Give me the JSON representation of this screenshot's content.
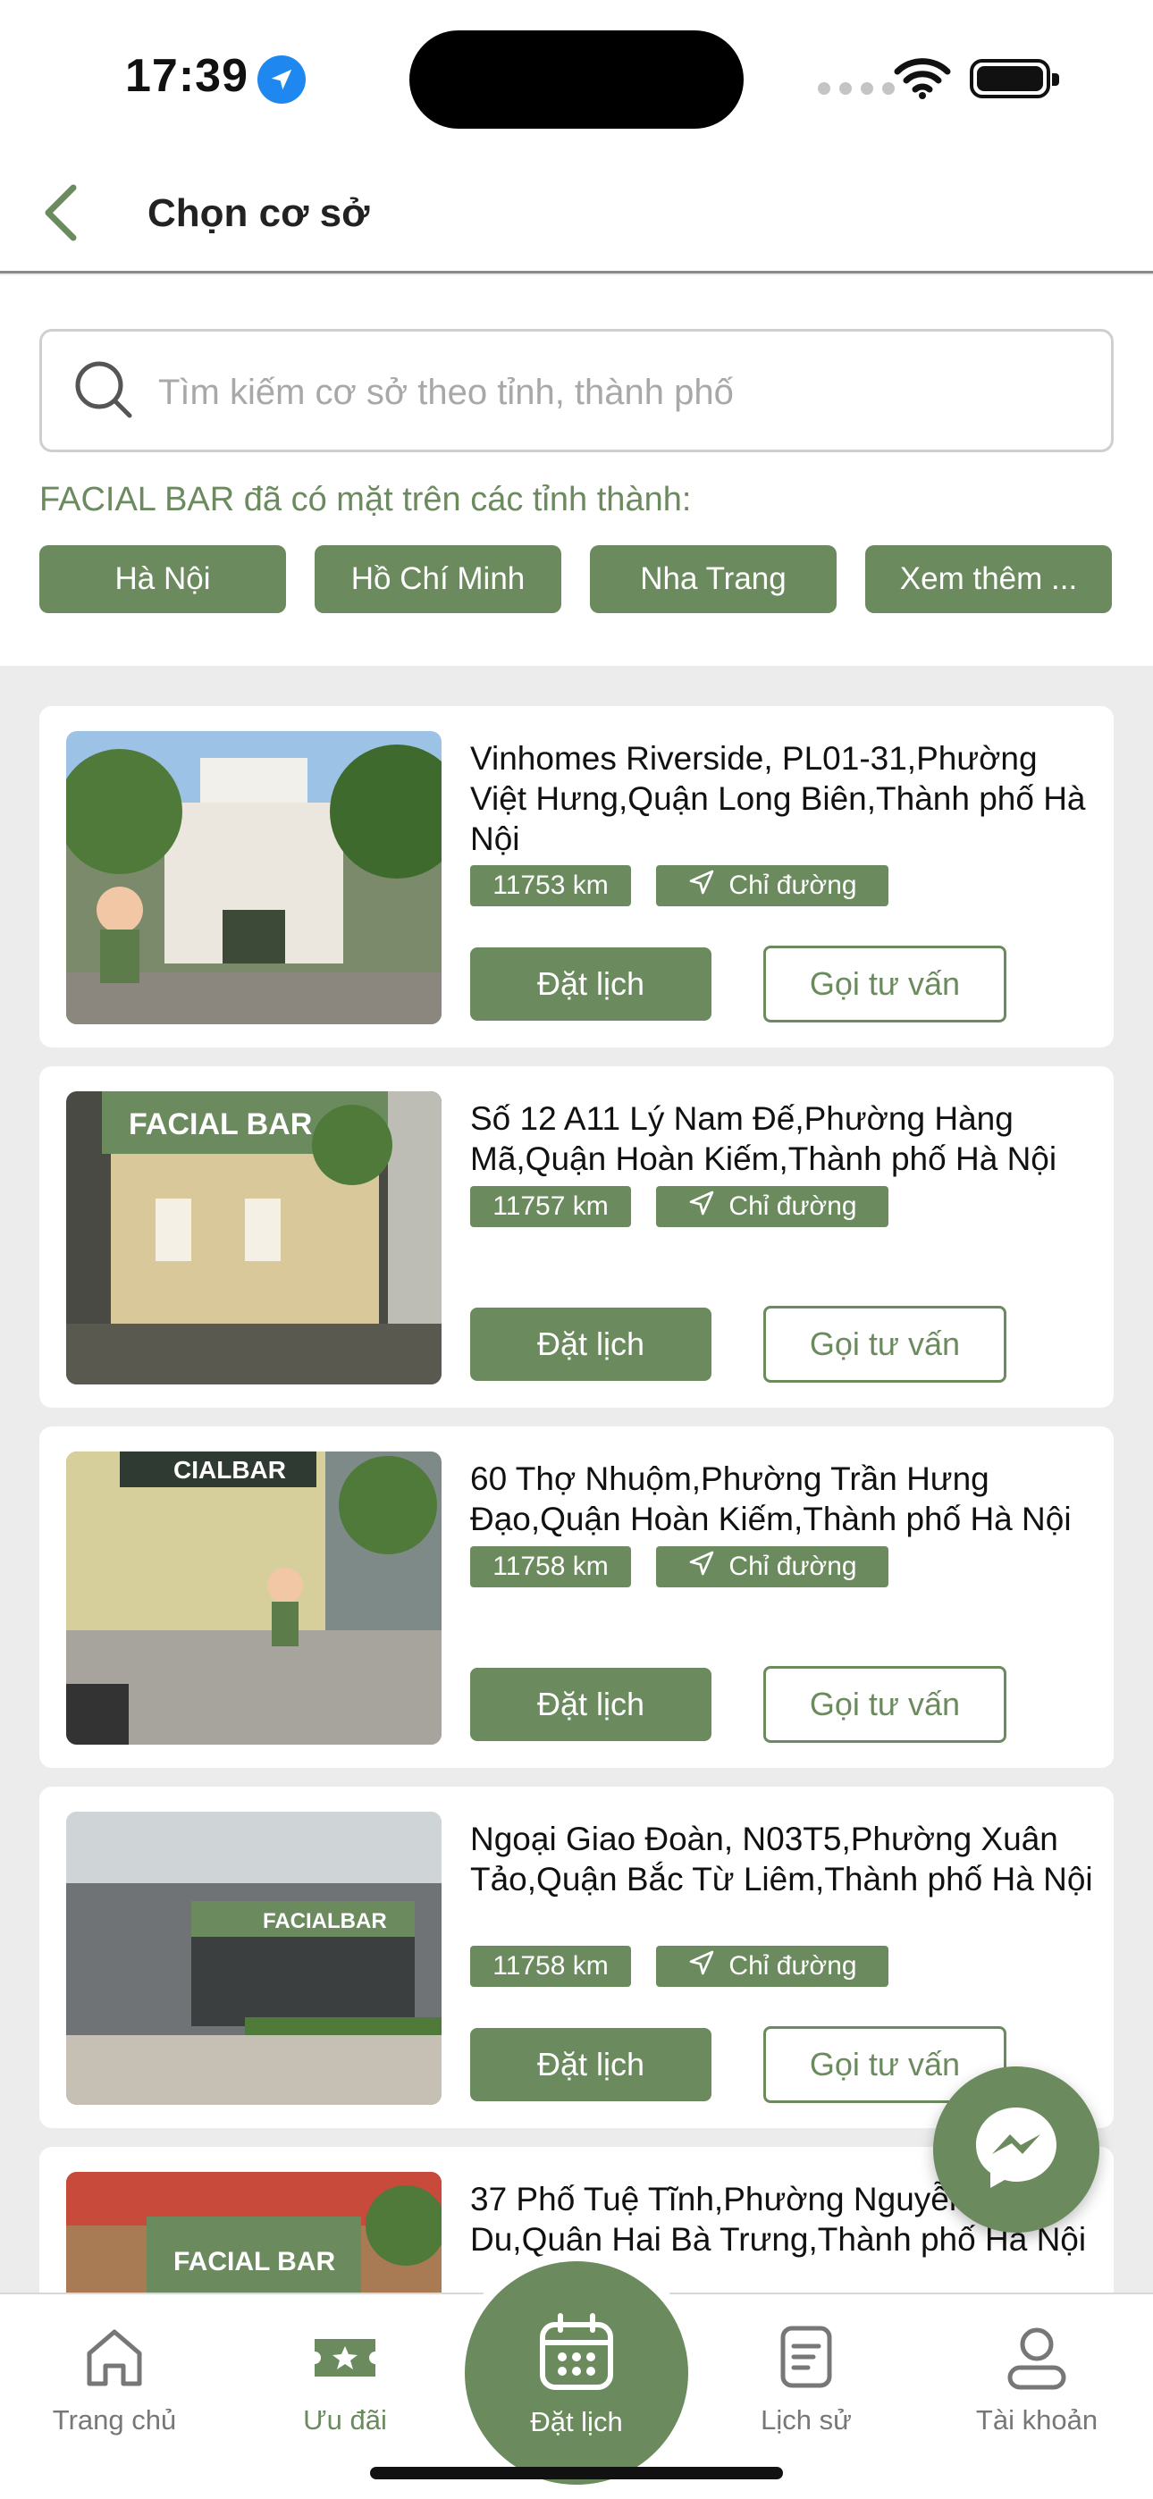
{
  "status": {
    "time": "17:39"
  },
  "header": {
    "title": "Chọn cơ sở"
  },
  "search": {
    "placeholder": "Tìm kiếm cơ sở theo tỉnh, thành phố"
  },
  "present_text": "FACIAL BAR đã có mặt trên các tỉnh thành:",
  "cities": [
    "Hà Nội",
    "Hồ Chí Minh",
    "Nha Trang",
    "Xem thêm ..."
  ],
  "branches": [
    {
      "address": "Vinhomes Riverside, PL01-31,Phường Việt Hưng,Quận Long Biên,Thành phố Hà Nội",
      "distance": "11753 km",
      "route": "Chỉ đường",
      "book": "Đặt lịch",
      "consult": "Gọi tư vấn"
    },
    {
      "address": "Số 12 A11 Lý Nam Đế,Phường Hàng Mã,Quận Hoàn Kiếm,Thành phố Hà Nội",
      "distance": "11757 km",
      "route": "Chỉ đường",
      "book": "Đặt lịch",
      "consult": "Gọi tư vấn"
    },
    {
      "address": "60 Thợ Nhuộm,Phường Trần Hưng Đạo,Quận Hoàn Kiếm,Thành phố Hà Nội",
      "distance": "11758 km",
      "route": "Chỉ đường",
      "book": "Đặt lịch",
      "consult": "Gọi tư vấn"
    },
    {
      "address": "Ngoại Giao Đoàn, N03T5,Phường Xuân Tảo,Quận Bắc Từ Liêm,Thành phố Hà Nội",
      "distance": "11758 km",
      "route": "Chỉ đường",
      "book": "Đặt lịch",
      "consult": "Gọi tư vấn"
    },
    {
      "address": "37 Phố Tuệ Tĩnh,Phường Nguyễn Du,Quận Hai Bà Trưng,Thành phố Hà Nội",
      "distance": "",
      "route": "",
      "book": "",
      "consult": ""
    }
  ],
  "tabs": {
    "home": "Trang chủ",
    "offers": "Ưu đãi",
    "booking": "Đặt lịch",
    "history": "Lịch sử",
    "account": "Tài khoản"
  },
  "colors": {
    "brand": "#6b8a5e",
    "background": "#ececec"
  }
}
